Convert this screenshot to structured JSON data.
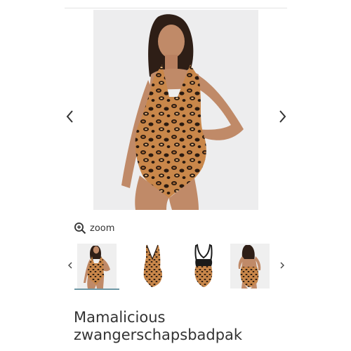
{
  "gallery": {
    "main_image": {
      "alt": "model-wearing-leopard-maternity-swimsuit",
      "print_colors": [
        "#c9874a",
        "#2a1a10",
        "#e2b27a"
      ]
    },
    "prev_icon": "chevron-left-icon",
    "next_icon": "chevron-right-icon",
    "zoom_label": "zoom",
    "zoom_icon": "magnifier-plus-icon",
    "thumbnails": [
      {
        "view": "model-front",
        "active": true
      },
      {
        "view": "product-front"
      },
      {
        "view": "product-back"
      },
      {
        "view": "model-back"
      }
    ],
    "accent_color": "#6e98a6"
  },
  "product": {
    "title": "Mamalicious zwangerschapsbadpak"
  }
}
